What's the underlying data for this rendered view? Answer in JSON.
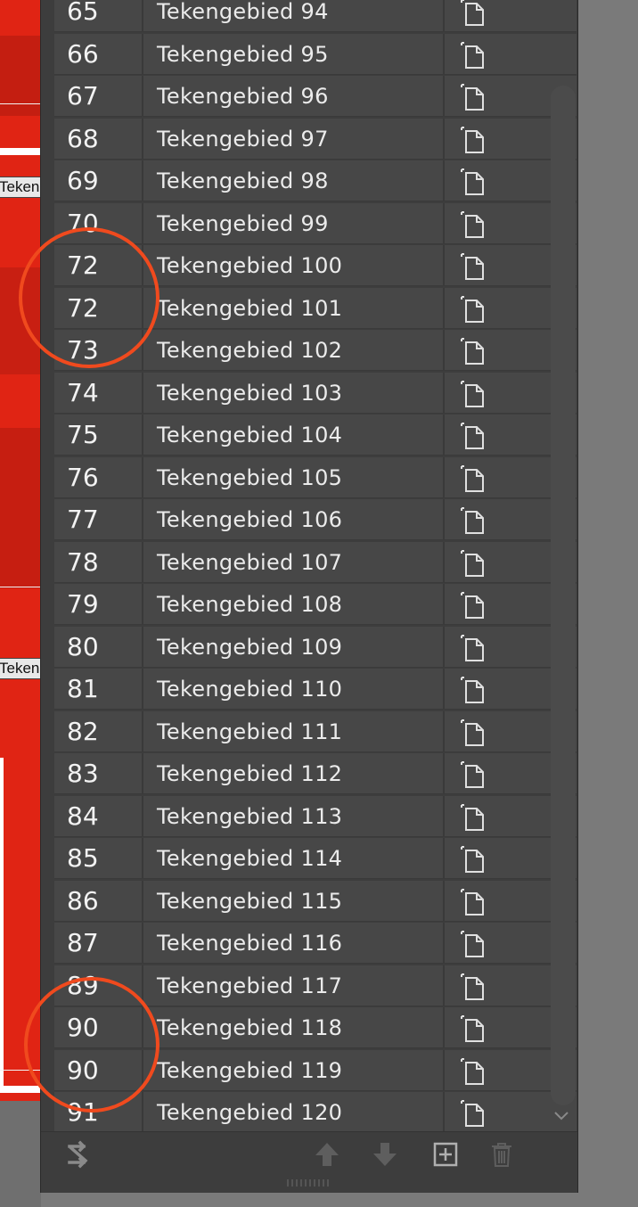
{
  "canvas": {
    "artboard_label_1": "Tekengebied",
    "artboard_label_2": "Tekengebied"
  },
  "artboards_panel": {
    "rows": [
      {
        "number": "65",
        "name": "Tekengebied 94"
      },
      {
        "number": "66",
        "name": "Tekengebied 95"
      },
      {
        "number": "67",
        "name": "Tekengebied 96"
      },
      {
        "number": "68",
        "name": "Tekengebied 97"
      },
      {
        "number": "69",
        "name": "Tekengebied 98"
      },
      {
        "number": "70",
        "name": "Tekengebied 99"
      },
      {
        "number": "72",
        "name": "Tekengebied 100"
      },
      {
        "number": "72",
        "name": "Tekengebied 101"
      },
      {
        "number": "73",
        "name": "Tekengebied 102"
      },
      {
        "number": "74",
        "name": "Tekengebied 103"
      },
      {
        "number": "75",
        "name": "Tekengebied 104"
      },
      {
        "number": "76",
        "name": "Tekengebied 105"
      },
      {
        "number": "77",
        "name": "Tekengebied 106"
      },
      {
        "number": "78",
        "name": "Tekengebied 107"
      },
      {
        "number": "79",
        "name": "Tekengebied 108"
      },
      {
        "number": "80",
        "name": "Tekengebied 109"
      },
      {
        "number": "81",
        "name": "Tekengebied 110"
      },
      {
        "number": "82",
        "name": "Tekengebied 111"
      },
      {
        "number": "83",
        "name": "Tekengebied 112"
      },
      {
        "number": "84",
        "name": "Tekengebied 113"
      },
      {
        "number": "85",
        "name": "Tekengebied 114"
      },
      {
        "number": "86",
        "name": "Tekengebied 115"
      },
      {
        "number": "87",
        "name": "Tekengebied 116"
      },
      {
        "number": "89",
        "name": "Tekengebied 117"
      },
      {
        "number": "90",
        "name": "Tekengebied 118"
      },
      {
        "number": "90",
        "name": "Tekengebied 119"
      },
      {
        "number": "91",
        "name": "Tekengebied 120"
      }
    ],
    "row_icon": "artboard-options-icon",
    "footer_icons": [
      "rearrange-artboards-icon",
      "move-up-icon",
      "move-down-icon",
      "new-artboard-icon",
      "delete-artboard-icon"
    ]
  },
  "colors": {
    "panel_bg": "#3d3d3d",
    "row_bg": "#474747",
    "annotation": "#f04a1e",
    "canvas_red": "#e02414"
  }
}
